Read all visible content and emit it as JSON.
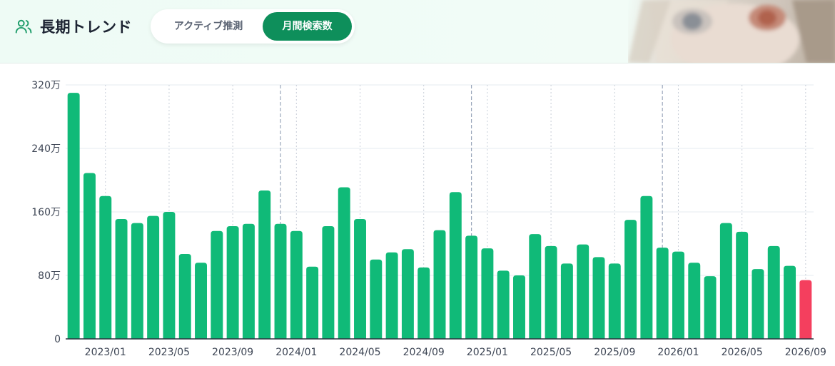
{
  "header": {
    "title": "長期トレンド",
    "tabs": [
      {
        "label": "アクティブ推測",
        "active": false
      },
      {
        "label": "月間検索数",
        "active": true
      }
    ]
  },
  "icons": {
    "title_icon": "users-icon",
    "avatar": "character-avatar"
  },
  "colors": {
    "bar": "#10ba78",
    "highlight_bar": "#f43f5e",
    "accent": "#0e8f5b"
  },
  "chart_data": {
    "type": "bar",
    "y_ticks": [
      {
        "value": 0,
        "label": "0"
      },
      {
        "value": 800000,
        "label": "80万"
      },
      {
        "value": 1600000,
        "label": "160万"
      },
      {
        "value": 2400000,
        "label": "240万"
      },
      {
        "value": 3200000,
        "label": "320万"
      }
    ],
    "ylim": [
      0,
      3200000
    ],
    "x_tick_labels": [
      "2023/01",
      "2023/05",
      "2023/09",
      "2024/01",
      "2024/05",
      "2024/09",
      "2025/01",
      "2025/05",
      "2025/09",
      "2026/01",
      "2026/05",
      "2026/09"
    ],
    "x_tick_index": [
      2,
      6,
      10,
      14,
      18,
      22,
      26,
      30,
      34,
      38,
      42,
      46
    ],
    "year_line_index": [
      13,
      25,
      37
    ],
    "highlight_index": 46,
    "categories": [
      "2022/11",
      "2022/12",
      "2023/01",
      "2023/02",
      "2023/03",
      "2023/04",
      "2023/05",
      "2023/06",
      "2023/07",
      "2023/08",
      "2023/09",
      "2023/10",
      "2023/11",
      "2023/12",
      "2024/01",
      "2024/02",
      "2024/03",
      "2024/04",
      "2024/05",
      "2024/06",
      "2024/07",
      "2024/08",
      "2024/09",
      "2024/10",
      "2024/11",
      "2024/12",
      "2025/01",
      "2025/02",
      "2025/03",
      "2025/04",
      "2025/05",
      "2025/06",
      "2025/07",
      "2025/08",
      "2025/09",
      "2025/10",
      "2025/11",
      "2025/12",
      "2026/01",
      "2026/02",
      "2026/03",
      "2026/04",
      "2026/05",
      "2026/06",
      "2026/07",
      "2026/08",
      "2026/09"
    ],
    "values": [
      3100000,
      2090000,
      1800000,
      1510000,
      1460000,
      1550000,
      1600000,
      1070000,
      960000,
      1360000,
      1420000,
      1450000,
      1870000,
      1450000,
      1360000,
      910000,
      1420000,
      1910000,
      1510000,
      1000000,
      1090000,
      1130000,
      900000,
      1370000,
      1850000,
      1300000,
      1140000,
      860000,
      800000,
      1320000,
      1170000,
      950000,
      1190000,
      1030000,
      950000,
      1500000,
      1800000,
      1150000,
      1100000,
      960000,
      790000,
      1460000,
      1350000,
      880000,
      1170000,
      920000,
      740000
    ],
    "grid": true
  }
}
